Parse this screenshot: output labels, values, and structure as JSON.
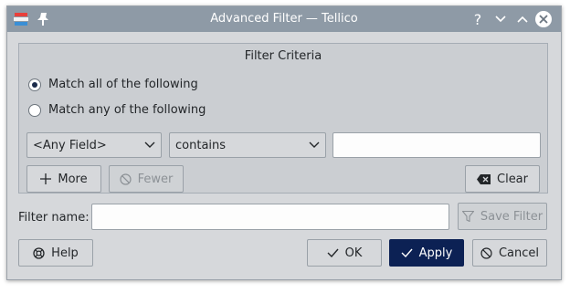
{
  "window": {
    "title": "Advanced Filter — Tellico",
    "accent": "#8e9aa6"
  },
  "titlebar": {
    "help_symbol": "?",
    "icons": [
      "tellico-app-icon",
      "pin-icon",
      "help-icon",
      "minimize-icon",
      "maximize-icon",
      "close-icon"
    ]
  },
  "criteria": {
    "heading": "Filter Criteria",
    "match_all_label": "Match all of the following",
    "match_any_label": "Match any of the following",
    "match_mode": "all",
    "field_combo": "<Any Field>",
    "operator_combo": "contains",
    "value": "",
    "more_label": "More",
    "fewer_label": "Fewer",
    "clear_label": "Clear"
  },
  "filter_name": {
    "label": "Filter name:",
    "value": "",
    "save_label": "Save Filter"
  },
  "buttons": {
    "help": "Help",
    "ok": "OK",
    "apply": "Apply",
    "cancel": "Cancel"
  },
  "colors": {
    "primary_button": "#0c2154",
    "dialog_bg": "#d6d8db"
  }
}
